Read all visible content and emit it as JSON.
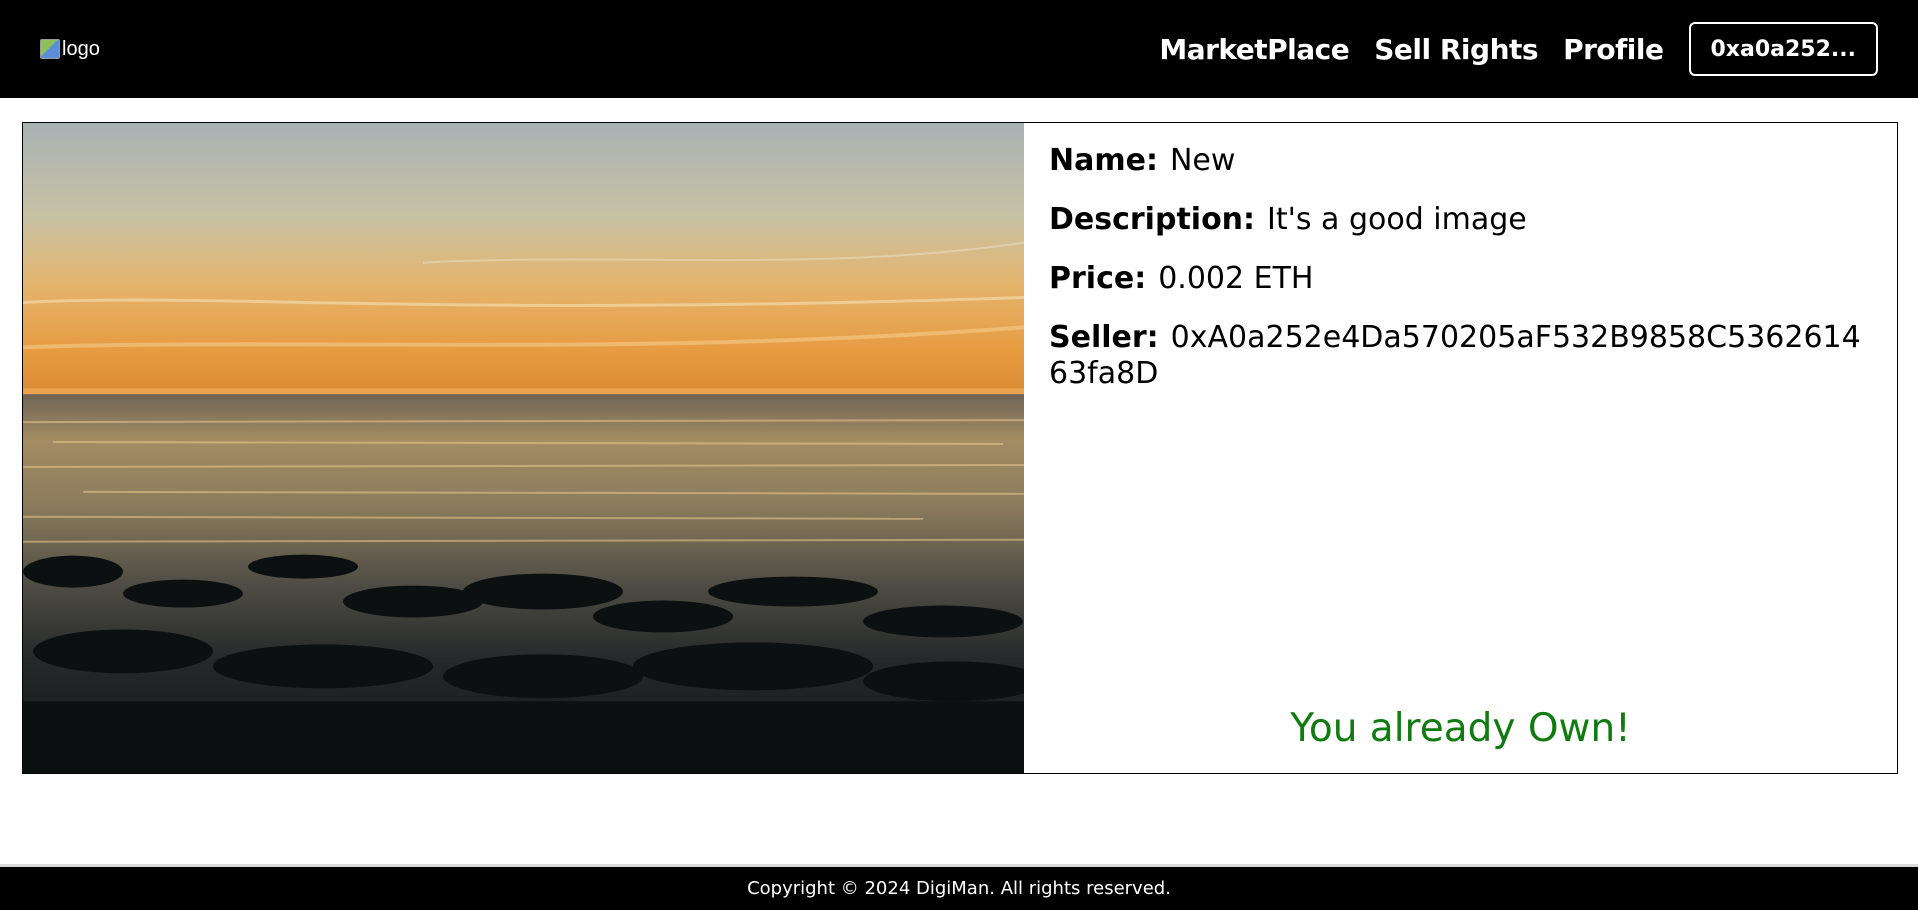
{
  "navbar": {
    "logo_alt": "logo",
    "links": [
      {
        "label": "MarketPlace"
      },
      {
        "label": "Sell Rights"
      },
      {
        "label": "Profile"
      }
    ],
    "wallet_label": "0xa0a252..."
  },
  "item": {
    "name_label": "Name:",
    "name": "New",
    "description_label": "Description:",
    "description": "It's a good image",
    "price_label": "Price:",
    "price": "0.002 ETH",
    "seller_label": "Seller:",
    "seller": "0xA0a252e4Da570205aF532B9858C536261463fa8D",
    "status": "You already Own!"
  },
  "colors": {
    "owned_text": "#117a11",
    "navbar_bg": "#000000"
  },
  "footer": {
    "copyright": "Copyright © 2024 DigiMan. All rights reserved."
  }
}
